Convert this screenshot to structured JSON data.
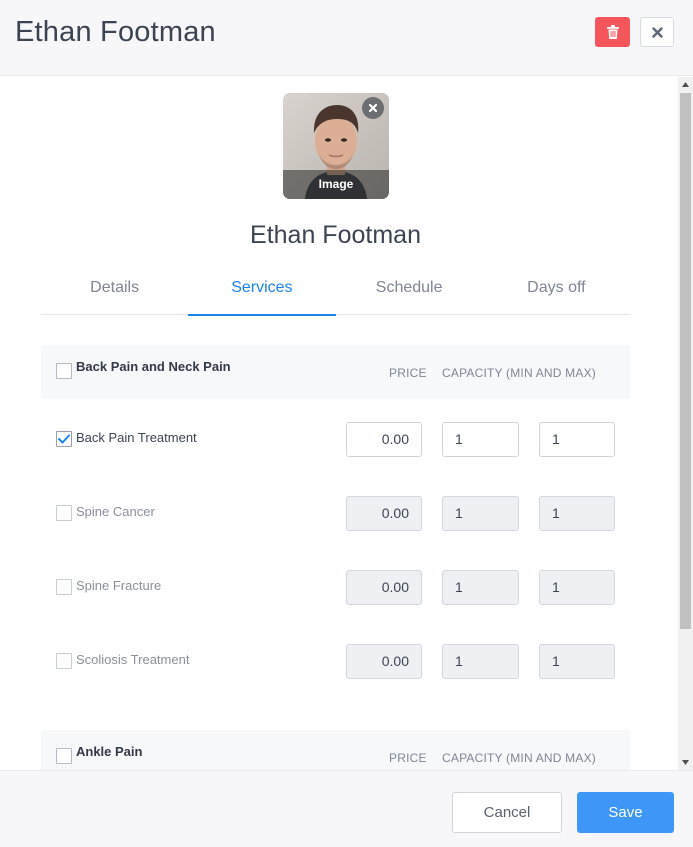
{
  "header": {
    "title": "Ethan Footman",
    "delete_icon": "trash-icon",
    "close_icon": "close-icon"
  },
  "avatar": {
    "caption": "Image",
    "remove_icon": "remove-icon"
  },
  "profile": {
    "name": "Ethan Footman"
  },
  "tabs": [
    {
      "label": "Details",
      "active": false
    },
    {
      "label": "Services",
      "active": true
    },
    {
      "label": "Schedule",
      "active": false
    },
    {
      "label": "Days off",
      "active": false
    }
  ],
  "categories": [
    {
      "name": "Back Pain and Neck Pain",
      "price_header": "PRICE",
      "capacity_header": "CAPACITY (MIN AND MAX)",
      "checked": false,
      "services": [
        {
          "name": "Back Pain Treatment",
          "checked": true,
          "price": "0.00",
          "min": "1",
          "max": "1"
        },
        {
          "name": "Spine Cancer",
          "checked": false,
          "price": "0.00",
          "min": "1",
          "max": "1"
        },
        {
          "name": "Spine Fracture",
          "checked": false,
          "price": "0.00",
          "min": "1",
          "max": "1"
        },
        {
          "name": "Scoliosis Treatment",
          "checked": false,
          "price": "0.00",
          "min": "1",
          "max": "1"
        }
      ]
    },
    {
      "name": "Ankle Pain",
      "price_header": "PRICE",
      "capacity_header": "CAPACITY (MIN AND MAX)",
      "checked": false,
      "services": []
    }
  ],
  "footer": {
    "cancel_label": "Cancel",
    "save_label": "Save"
  },
  "colors": {
    "accent": "#1a84ee",
    "save": "#3e96f7",
    "delete": "#f5565c"
  }
}
